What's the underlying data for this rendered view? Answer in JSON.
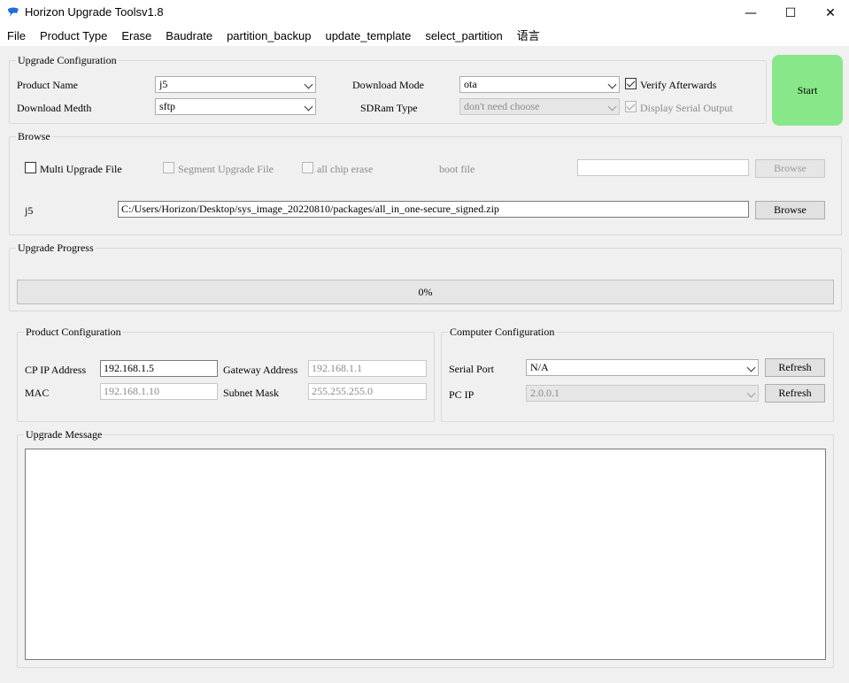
{
  "window": {
    "title": "Horizon Upgrade Toolsv1.8",
    "minimize": "—",
    "maximize": "☐",
    "close": "✕"
  },
  "menu": [
    "File",
    "Product Type",
    "Erase",
    "Baudrate",
    "partition_backup",
    "update_template",
    "select_partition",
    "语言"
  ],
  "upgrade_config": {
    "title": "Upgrade Configuration",
    "product_name_label": "Product Name",
    "product_name_value": "j5",
    "download_medth_label": "Download Medth",
    "download_medth_value": "sftp",
    "download_mode_label": "Download Mode",
    "download_mode_value": "ota",
    "sdram_type_label": "SDRam Type",
    "sdram_type_value": "don't need choose",
    "verify_label": "Verify Afterwards",
    "verify_checked": true,
    "display_serial_label": "Display Serial Output",
    "display_serial_checked": true
  },
  "start_button": "Start",
  "browse": {
    "title": "Browse",
    "multi_upgrade_label": "Multi Upgrade File",
    "segment_upgrade_label": "Segment Upgrade File",
    "all_chip_erase_label": "all chip erase",
    "boot_file_label": "boot file",
    "boot_file_value": "",
    "boot_browse_label": "Browse",
    "file_label": "j5",
    "file_path": "C:/Users/Horizon/Desktop/sys_image_20220810/packages/all_in_one-secure_signed.zip",
    "file_browse_label": "Browse"
  },
  "progress": {
    "title": "Upgrade Progress",
    "percent": 0,
    "text": "0%"
  },
  "product_config": {
    "title": "Product Configuration",
    "cp_ip_label": "CP IP Address",
    "cp_ip_value": "192.168.1.5",
    "gateway_label": "Gateway Address",
    "gateway_value": "192.168.1.1",
    "mac_label": "MAC",
    "mac_value": "192.168.1.10",
    "subnet_label": "Subnet Mask",
    "subnet_value": "255.255.255.0"
  },
  "computer_config": {
    "title": "Computer Configuration",
    "serial_port_label": "Serial Port",
    "serial_port_value": "N/A",
    "serial_refresh_label": "Refresh",
    "pc_ip_label": "PC IP",
    "pc_ip_value": "2.0.0.1",
    "pc_ip_refresh_label": "Refresh"
  },
  "message": {
    "title": "Upgrade Message",
    "content": ""
  },
  "colors": {
    "start_button": "#88e788",
    "window_bg": "#f0f0f0",
    "icon_blue": "#1e6fd9"
  }
}
